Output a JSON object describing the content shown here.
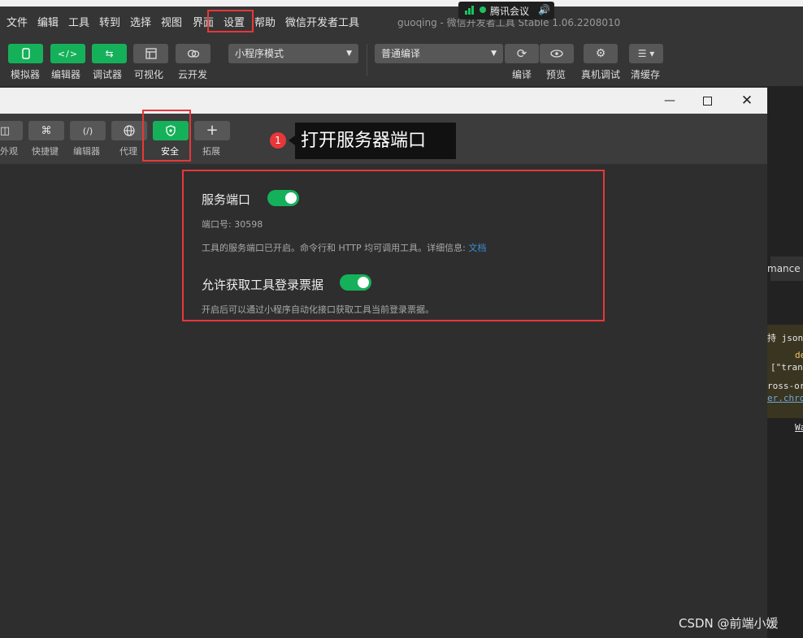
{
  "menu": {
    "items": [
      "文件",
      "编辑",
      "工具",
      "转到",
      "选择",
      "视图",
      "界面",
      "设置",
      "帮助",
      "微信开发者工具"
    ],
    "title": "guoqing - 微信开发者工具 Stable 1.06.2208010"
  },
  "meeting": {
    "label": "腾讯会议"
  },
  "toolbar": {
    "simulator": "模拟器",
    "editor": "编辑器",
    "debugger": "调试器",
    "visual": "可视化",
    "cloud": "云开发",
    "mode_select": "小程序模式",
    "compile_select": "普通编译",
    "compile": "编译",
    "preview": "预览",
    "real_debug": "真机调试",
    "clear_cache": "清缓存"
  },
  "settings_tabs": {
    "appearance": "外观",
    "shortcuts": "快捷键",
    "editor": "编辑器",
    "proxy": "代理",
    "security": "安全",
    "extensions": "拓展"
  },
  "callout": {
    "number": "1",
    "text": "打开服务器端口"
  },
  "security": {
    "service_port": {
      "title": "服务端口",
      "enabled": true,
      "port_label": "端口号: 30598",
      "desc": "工具的服务端口已开启。命令行和 HTTP 均可调用工具。详细信息: ",
      "link": "文档"
    },
    "login_ticket": {
      "title": "允许获取工具登录票据",
      "enabled": true,
      "desc": "开启后可以通过小程序自动化接口获取工具当前登录票据。"
    }
  },
  "devtools_peek": {
    "tab": "mance",
    "line1": "持 json",
    "line2": "de",
    "line3": "[\"tran",
    "line4": "ross-or",
    "line5": "er.chro",
    "line6": "Wa"
  },
  "watermark": "CSDN @前端小媛"
}
